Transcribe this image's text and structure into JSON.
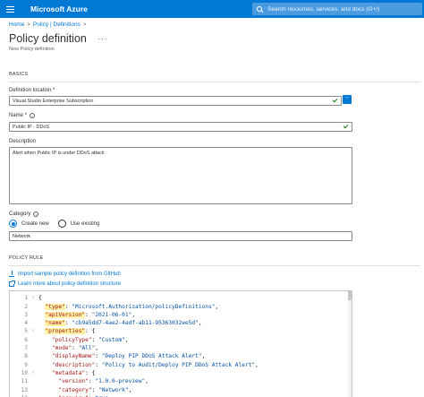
{
  "topbar": {
    "brand": "Microsoft Azure",
    "search_placeholder": "Search resources, services, and docs (G+/)"
  },
  "breadcrumb": [
    "Home",
    "Policy | Definitions"
  ],
  "page": {
    "title": "Policy definition",
    "subtitle": "New Policy definition"
  },
  "basics": {
    "section_label": "BASICS",
    "definition_location_label": "Definition location *",
    "definition_location_value": "Visual Studio Enterprise Subscription",
    "browse_label": "...",
    "name_label": "Name *",
    "name_value": "Public IP - DDoS",
    "description_label": "Description",
    "description_value": "Alert when Public IP is under DDoS attack",
    "category_label": "Category",
    "category_options": [
      "Create new",
      "Use existing"
    ],
    "category_selected": "Create new",
    "category_value": "Network"
  },
  "policy_rule": {
    "section_label": "POLICY RULE",
    "import_link": "Import sample policy definition from GitHub",
    "learn_link": "Learn more about policy definition structure",
    "code_lines": [
      {
        "n": "1",
        "fold": "˅",
        "indent": "",
        "key": "",
        "value": "",
        "punct": "{"
      },
      {
        "n": "2",
        "fold": "",
        "indent": "  ",
        "key": "\"type\"",
        "value": "\"Microsoft.Authorization/policyDefinitions\"",
        "punct": ","
      },
      {
        "n": "3",
        "fold": "",
        "indent": "  ",
        "key": "\"apiVersion\"",
        "value": "\"2021-06-01\"",
        "punct": ","
      },
      {
        "n": "4",
        "fold": "",
        "indent": "  ",
        "key": "\"name\"",
        "value": "\"cb9a5dd7-4ae2-4adf-ab11-95363032ee5d\"",
        "punct": ","
      },
      {
        "n": "5",
        "fold": "˅",
        "indent": "  ",
        "key": "\"properties\"",
        "value": "",
        "punct": "{"
      },
      {
        "n": "6",
        "fold": "",
        "indent": "    ",
        "key": "\"policyType\"",
        "value": "\"Custom\"",
        "punct": ","
      },
      {
        "n": "7",
        "fold": "",
        "indent": "    ",
        "key": "\"mode\"",
        "value": "\"All\"",
        "punct": ","
      },
      {
        "n": "8",
        "fold": "",
        "indent": "    ",
        "key": "\"displayName\"",
        "value": "\"Deploy PIP DDoS Attack Alert\"",
        "punct": ","
      },
      {
        "n": "9",
        "fold": "",
        "indent": "    ",
        "key": "\"description\"",
        "value": "\"Policy to Audit/Deploy PIP DDoS Attack Alert\"",
        "punct": ","
      },
      {
        "n": "10",
        "fold": "˅",
        "indent": "    ",
        "key": "\"metadata\"",
        "value": "",
        "punct": "{"
      },
      {
        "n": "11",
        "fold": "",
        "indent": "      ",
        "key": "\"version\"",
        "value": "\"1.0.0-preview\"",
        "punct": ","
      },
      {
        "n": "12",
        "fold": "",
        "indent": "      ",
        "key": "\"category\"",
        "value": "\"Network\"",
        "punct": ","
      },
      {
        "n": "13",
        "fold": "",
        "indent": "      ",
        "key": "\"preview\"",
        "value": "true",
        "punct": ","
      }
    ]
  },
  "colors": {
    "azure_blue": "#0078d4",
    "json_key": "#a31515",
    "json_string": "#0451a5",
    "valid_check": "#107c10"
  }
}
